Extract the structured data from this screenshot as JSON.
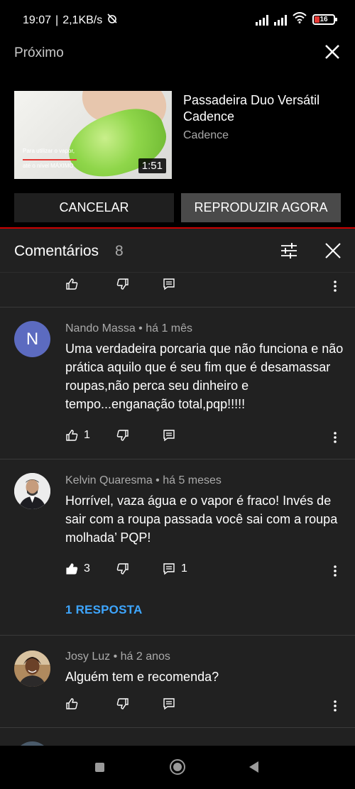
{
  "status_bar": {
    "time": "19:07",
    "speed": "2,1KB/s",
    "battery": "16"
  },
  "up_next": {
    "title": "Próximo",
    "video_title": "Passadeira Duo Versátil Cadence",
    "channel": "Cadence",
    "duration": "1:51",
    "thumb_caption_1": "Para utilizar o vapor,",
    "thumb_caption_2": "até o nível MÁXIMO",
    "cancel_label": "CANCELAR",
    "play_now_label": "REPRODUZIR AGORA"
  },
  "comments": {
    "title": "Comentários",
    "count": "8",
    "items": [
      {
        "author": "Nando Massa",
        "time": "há 1 mês",
        "avatar_letter": "N",
        "text": "Uma verdadeira porcaria que não funciona e não prática aquilo que é seu fim que é desamassar roupas,não perca seu dinheiro e tempo...enganação total,pqp!!!!!",
        "likes": "1",
        "replies_count": ""
      },
      {
        "author": "Kelvin Quaresma",
        "time": "há 5 meses",
        "text": "Horrível, vaza água e o vapor é fraco! Invés de sair com a roupa passada você sai com a roupa molhada’ PQP!",
        "likes": "3",
        "replies_count": "1",
        "reply_link": "1 RESPOSTA"
      },
      {
        "author": "Josy Luz",
        "time": "há 2 anos",
        "text": "Alguém tem e recomenda?",
        "likes": "",
        "replies_count": ""
      }
    ]
  },
  "colors": {
    "accent_link": "#3ea6ff",
    "divider_red": "#cc0000",
    "panel_bg": "#212121"
  },
  "icons": [
    "close-icon",
    "filter-icon",
    "like-icon",
    "dislike-icon",
    "reply-icon",
    "more-icon",
    "recents-icon",
    "home-icon",
    "back-icon"
  ]
}
